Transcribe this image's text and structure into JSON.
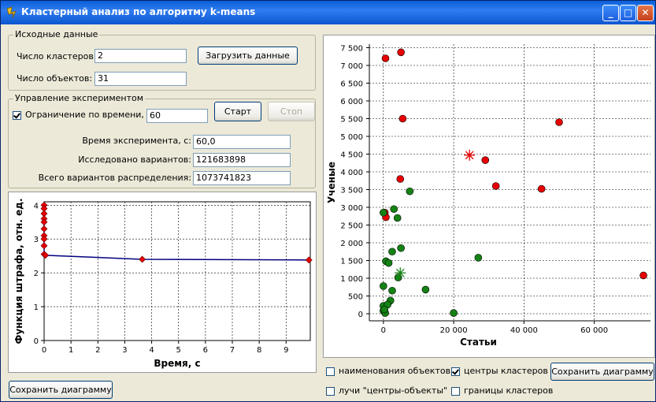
{
  "window": {
    "title": "Кластерный анализ по алгоритму k-means",
    "controls": {
      "minimize": "_",
      "maximize": "□",
      "close": "✕"
    }
  },
  "source_group": {
    "title": "Исходные данные",
    "clusters_label": "Число кластеров:",
    "clusters_value": "2",
    "objects_label": "Число объектов:",
    "objects_value": "31",
    "load_button": "Загрузить данные"
  },
  "experiment_group": {
    "title": "Управление экспериментом",
    "time_limit_label": "Ограничение по времени, с",
    "time_limit_checked": true,
    "time_limit_value": "60",
    "start_button": "Старт",
    "stop_button": "Стоп",
    "time_label": "Время эксперимента, с:",
    "time_value": "60,0",
    "explored_label": "Исследовано вариантов:",
    "explored_value": "121683898",
    "total_label": "Всего вариантов распределения:",
    "total_value": "1073741823"
  },
  "left_panel": {
    "save_button": "Сохранить диаграмму"
  },
  "right_panel": {
    "options": [
      {
        "label": "наименования объектов",
        "checked": false
      },
      {
        "label": "центры кластеров",
        "checked": true
      },
      {
        "label": "лучи \"центры-объекты\"",
        "checked": false
      },
      {
        "label": "границы кластеров",
        "checked": false
      }
    ],
    "save_button": "Сохранить диаграмму"
  },
  "colors": {
    "cluster1": "#e60000",
    "cluster2": "#148214",
    "line": "#00007f",
    "grid": "#000000"
  },
  "chart_data": [
    {
      "type": "line",
      "xlabel": "Время, с",
      "ylabel": "Функция штрафа, отн. ед.",
      "xlim": [
        0,
        9.9
      ],
      "ylim": [
        0,
        4.1
      ],
      "xticks": [
        "0",
        "1",
        "2",
        "3",
        "4",
        "5",
        "6",
        "7",
        "8",
        "9"
      ],
      "yticks": [
        "0",
        "1",
        "2",
        "3",
        "4"
      ],
      "x": [
        0,
        0,
        0,
        0,
        0,
        0,
        0,
        0,
        0,
        0,
        0.05,
        3.65,
        9.85
      ],
      "y": [
        4.0,
        3.9,
        3.75,
        3.6,
        3.5,
        3.3,
        3.1,
        3.0,
        2.8,
        2.55,
        2.52,
        2.4,
        2.38
      ],
      "grid": true
    },
    {
      "type": "scatter",
      "xlabel": "Статьи",
      "ylabel": "Ученые",
      "xlim": [
        -4000,
        76000
      ],
      "ylim": [
        -200,
        7600
      ],
      "xticks": [
        "0",
        "20 000",
        "40 000",
        "60 000"
      ],
      "yticks": [
        "0",
        "500",
        "1 000",
        "1 500",
        "2 000",
        "2 500",
        "3 000",
        "3 500",
        "4 000",
        "4 500",
        "5 000",
        "5 500",
        "6 000",
        "6 500",
        "7 000",
        "7 500"
      ],
      "grid": true,
      "series": [
        {
          "color": "#e60000",
          "points": [
            [
              600,
              7200
            ],
            [
              5000,
              7370
            ],
            [
              5500,
              5500
            ],
            [
              50000,
              5400
            ],
            [
              29000,
              4330
            ],
            [
              4800,
              3800
            ],
            [
              32000,
              3600
            ],
            [
              45000,
              3520
            ],
            [
              400,
              2850
            ],
            [
              700,
              2720
            ],
            [
              74000,
              1080
            ]
          ]
        },
        {
          "color": "#148214",
          "points": [
            [
              7500,
              3450
            ],
            [
              3000,
              2950
            ],
            [
              4000,
              2700
            ],
            [
              0,
              2850
            ],
            [
              2500,
              1750
            ],
            [
              5000,
              1850
            ],
            [
              27000,
              1580
            ],
            [
              700,
              1480
            ],
            [
              1500,
              1430
            ],
            [
              4200,
              1020
            ],
            [
              0,
              780
            ],
            [
              2500,
              650
            ],
            [
              12000,
              680
            ],
            [
              2000,
              370
            ],
            [
              0,
              220
            ],
            [
              1200,
              260
            ],
            [
              0,
              80
            ],
            [
              500,
              20
            ],
            [
              20000,
              20
            ],
            [
              300,
              120
            ]
          ]
        }
      ],
      "centers": [
        {
          "color": "#e60000",
          "point": [
            24500,
            4470
          ]
        },
        {
          "color": "#148214",
          "point": [
            4800,
            1150
          ]
        }
      ]
    }
  ]
}
